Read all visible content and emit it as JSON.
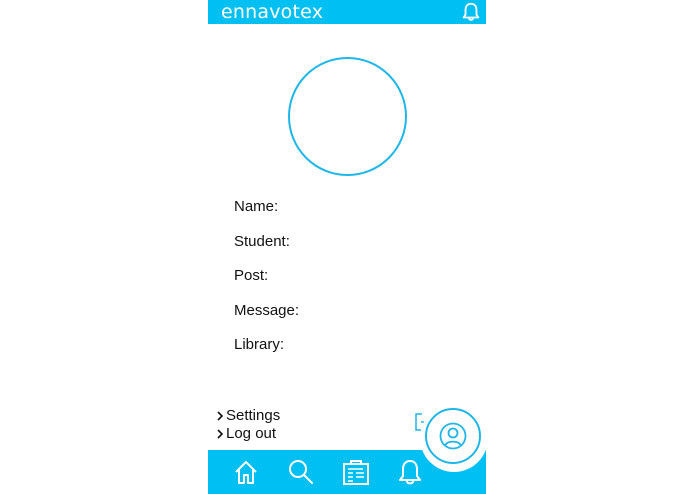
{
  "app": {
    "brand": "ennavotex",
    "accent_color": "#00bff3",
    "top_icon": "bell-icon"
  },
  "profile": {
    "avatar": "profile-photo-placeholder",
    "fields": [
      "Name:",
      "Student:",
      "Post:",
      "Message:",
      "Library:"
    ]
  },
  "menu": {
    "settings_label": "Settings",
    "logout_label": "Log out"
  },
  "bottom_nav": {
    "items": [
      "home-icon",
      "search-icon",
      "news-icon",
      "bell-icon"
    ],
    "fab": "user-profile-icon"
  }
}
